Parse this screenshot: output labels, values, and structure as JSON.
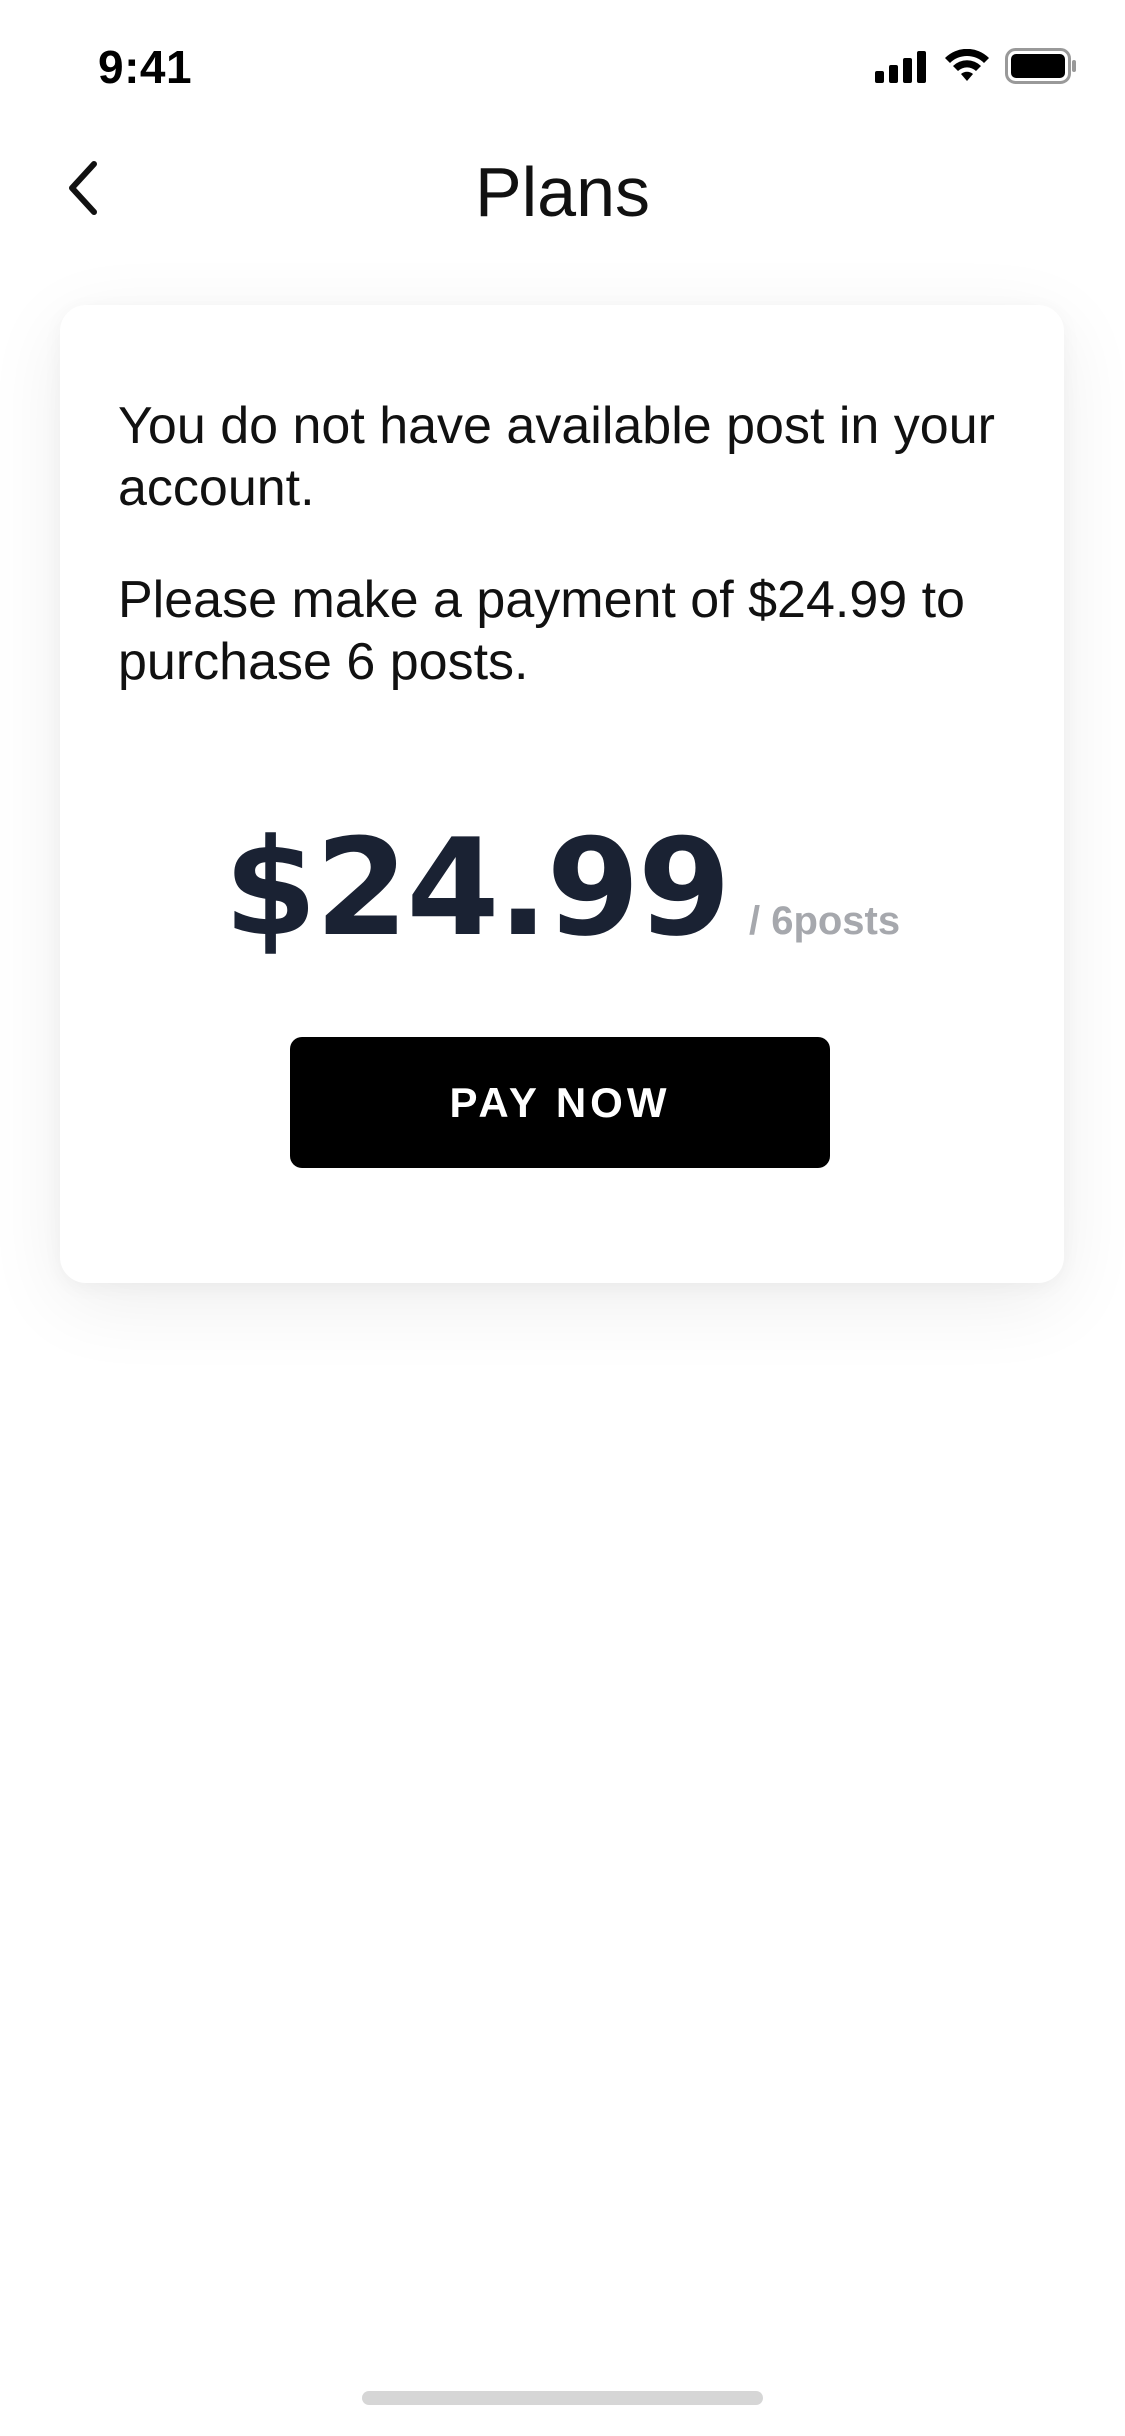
{
  "status_bar": {
    "time": "9:41",
    "icons": [
      "cellular-signal-icon",
      "wifi-icon",
      "battery-icon"
    ]
  },
  "header": {
    "title": "Plans",
    "back_icon": "chevron-left-icon"
  },
  "card": {
    "message_1": "You do not have available post in your account.",
    "message_2": "Please make a payment of $24.99 to purchase 6 posts.",
    "price": "$24.99",
    "price_unit": "/ 6posts",
    "pay_button_label": "PAY NOW"
  },
  "colors": {
    "price": "#1a2233",
    "unit": "#a6a8ad",
    "button_bg": "#000000",
    "button_text": "#ffffff"
  }
}
